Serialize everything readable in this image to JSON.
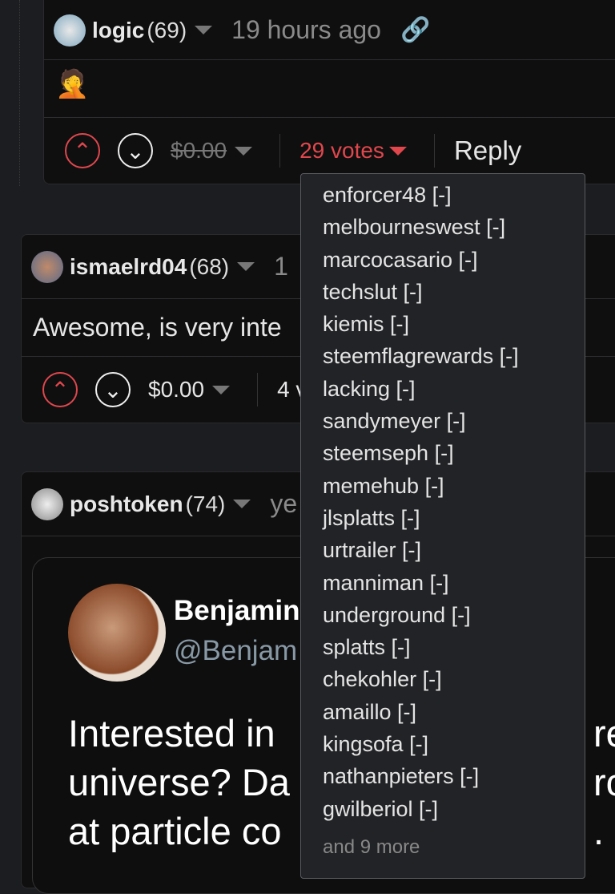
{
  "comments": [
    {
      "author": "logic",
      "reputation": "(69)",
      "time": "19 hours ago",
      "body": "🤦",
      "payout": "$0.00",
      "votes": "29 votes",
      "reply": "Reply"
    },
    {
      "author": "ismaelrd04",
      "reputation": "(68)",
      "time": "1",
      "body": "Awesome, is very inte",
      "payout": "$0.00",
      "votes": "4 v"
    },
    {
      "author": "poshtoken",
      "reputation": "(74)",
      "time": "ye"
    }
  ],
  "voters": [
    "enforcer48 [-]",
    "melbourneswest [-]",
    "marcocasario [-]",
    "techslut [-]",
    "kiemis [-]",
    "steemflagrewards [-]",
    "lacking [-]",
    "sandymeyer [-]",
    "steemseph [-]",
    "memehub [-]",
    "jlsplatts [-]",
    "urtrailer [-]",
    "manniman [-]",
    "underground [-]",
    "splatts [-]",
    "chekohler [-]",
    "amaillo [-]",
    "kingsofa [-]",
    "nathanpieters [-]",
    "gwilberiol [-]"
  ],
  "voters_more": "and 9 more",
  "tweet": {
    "name": "Benjamin",
    "handle": "@Benjam",
    "lines": [
      "Interested in",
      "universe? Da",
      "at particle co"
    ],
    "right": [
      "re",
      "rc",
      ". E"
    ]
  },
  "colors": {
    "accent": "#e0474c",
    "background": "#1c1d20",
    "card": "#0f0f10"
  }
}
